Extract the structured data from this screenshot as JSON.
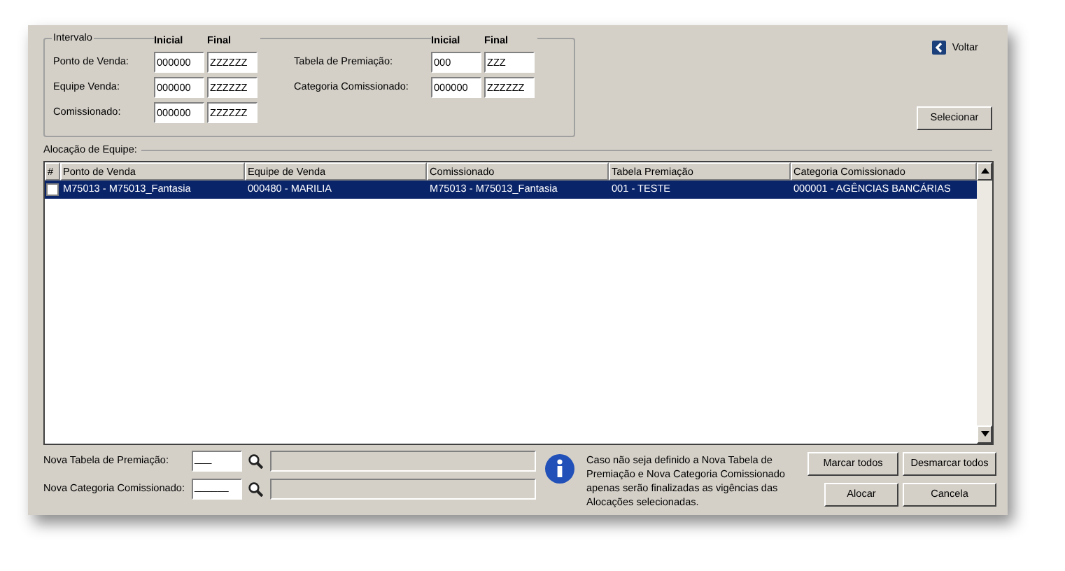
{
  "filter": {
    "title": "Intervalo",
    "left": {
      "headers": [
        "Inicial",
        "Final"
      ],
      "rows": [
        {
          "label": "Ponto de Venda:",
          "start": "000000",
          "end": "ZZZZZZ"
        },
        {
          "label": "Equipe Venda:",
          "start": "000000",
          "end": "ZZZZZZ"
        },
        {
          "label": "Comissionado:",
          "start": "000000",
          "end": "ZZZZZZ"
        }
      ]
    },
    "right": {
      "headers": [
        "Inicial",
        "Final"
      ],
      "rows": [
        {
          "label": "Tabela de Premiação:",
          "start": "000",
          "end": "ZZZ"
        },
        {
          "label": "Categoria Comissionado:",
          "start": "000000",
          "end": "ZZZZZZ"
        }
      ]
    }
  },
  "back_link": {
    "label": "Voltar"
  },
  "select_button": {
    "label": "Selecionar"
  },
  "table": {
    "title": "Alocação de Equipe:",
    "check_column": "#",
    "columns": [
      "Ponto de Venda",
      "Equipe de Venda",
      "Comissionado",
      "Tabela Premiação",
      "Categoria Comissionado"
    ],
    "rows": [
      {
        "selected": true,
        "checked": false,
        "cells": [
          "M75013 - M75013_Fantasia",
          "000480 - MARILIA",
          "M75013 - M75013_Fantasia",
          "001 - TESTE",
          "000001 - AGÊNCIAS BANCÁRIAS"
        ]
      }
    ]
  },
  "new_fields": [
    {
      "label": "Nova Tabela de Premiação:",
      "mask": "___"
    },
    {
      "label": "Nova Categoria Comissionado:",
      "mask": "______"
    }
  ],
  "info": "Caso não seja definido a Nova Tabela de Premiação e Nova Categoria Comissionado apenas serão finalizadas as vigências das Alocações selecionadas.",
  "buttons": [
    {
      "label": "Marcar todos"
    },
    {
      "label": "Desmarcar todos"
    },
    {
      "label": "Alocar"
    },
    {
      "label": "Cancela"
    }
  ]
}
